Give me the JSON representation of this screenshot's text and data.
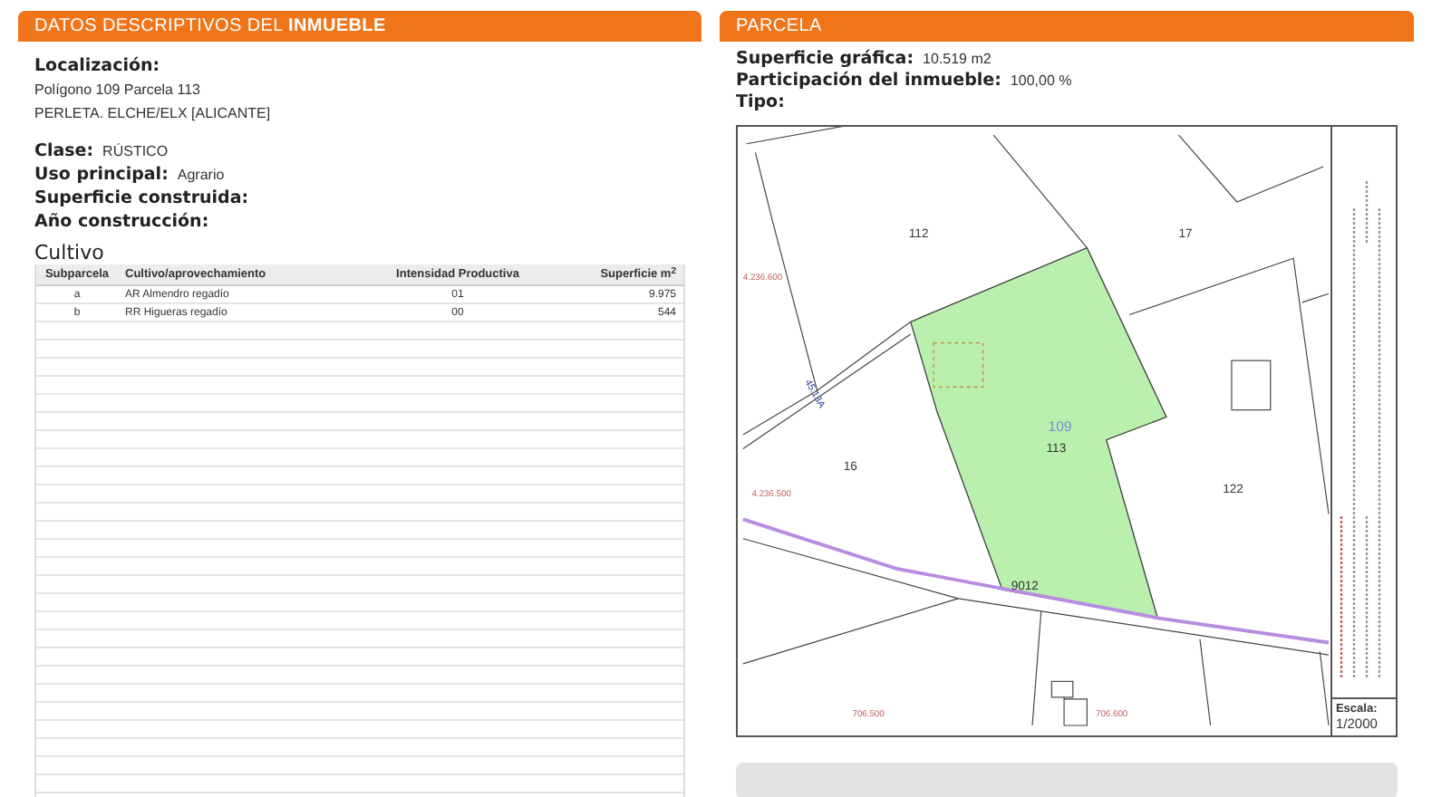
{
  "left_panel": {
    "title": "DATOS DESCRIPTIVOS DEL **INMUEBLE**",
    "location": {
      "label": "Localización:",
      "lines": [
        "Polígono 109 Parcela 113",
        "PERLETA. ELCHE/ELX [ALICANTE]"
      ]
    },
    "fields": [
      {
        "label": "Clase:",
        "value": "RÚSTICO"
      },
      {
        "label": "Uso principal:",
        "value": "Agrario"
      },
      {
        "label": "Superficie construida:"
      },
      {
        "label": "Año construcción:"
      }
    ],
    "crops": {
      "title": "Cultivo",
      "columns": [
        "Subparcela",
        "Cultivo/aprovechamiento",
        "Intensidad Productiva",
        "Superficie m$^{2}$"
      ],
      "rows": [
        [
          "a",
          "AR Almendro regadío",
          "01",
          "9.975"
        ],
        [
          "b",
          "RR Higueras regadío",
          "00",
          "544"
        ]
      ]
    }
  },
  "right_panel": {
    "title": "PARCELA",
    "fields": [
      {
        "label": "Superficie gráfica:",
        "value": "10.519 m2"
      },
      {
        "label": "Participación del inmueble:",
        "value": "100,00 %"
      },
      {
        "label": "Tipo:"
      }
    ],
    "map": {
      "parcel_labels": [
        {
          "text": "112",
          "kind": "parcel"
        },
        {
          "text": "17",
          "kind": "parcel"
        },
        {
          "text": "16",
          "kind": "parcel"
        },
        {
          "text": "122",
          "kind": "parcel"
        },
        {
          "text": "109",
          "kind": "polygon"
        },
        {
          "text": "113",
          "kind": "parcel"
        },
        {
          "text": "9012",
          "kind": "parcel"
        },
        {
          "text": "45.13A",
          "kind": "road"
        },
        {
          "text": "4.236.600",
          "kind": "coord"
        },
        {
          "text": "4.236.500",
          "kind": "coord"
        },
        {
          "text": "706.500",
          "kind": "coord"
        },
        {
          "text": "706.600",
          "kind": "coord"
        }
      ],
      "scale_label": "Escala:",
      "scale": "1/2000"
    }
  }
}
